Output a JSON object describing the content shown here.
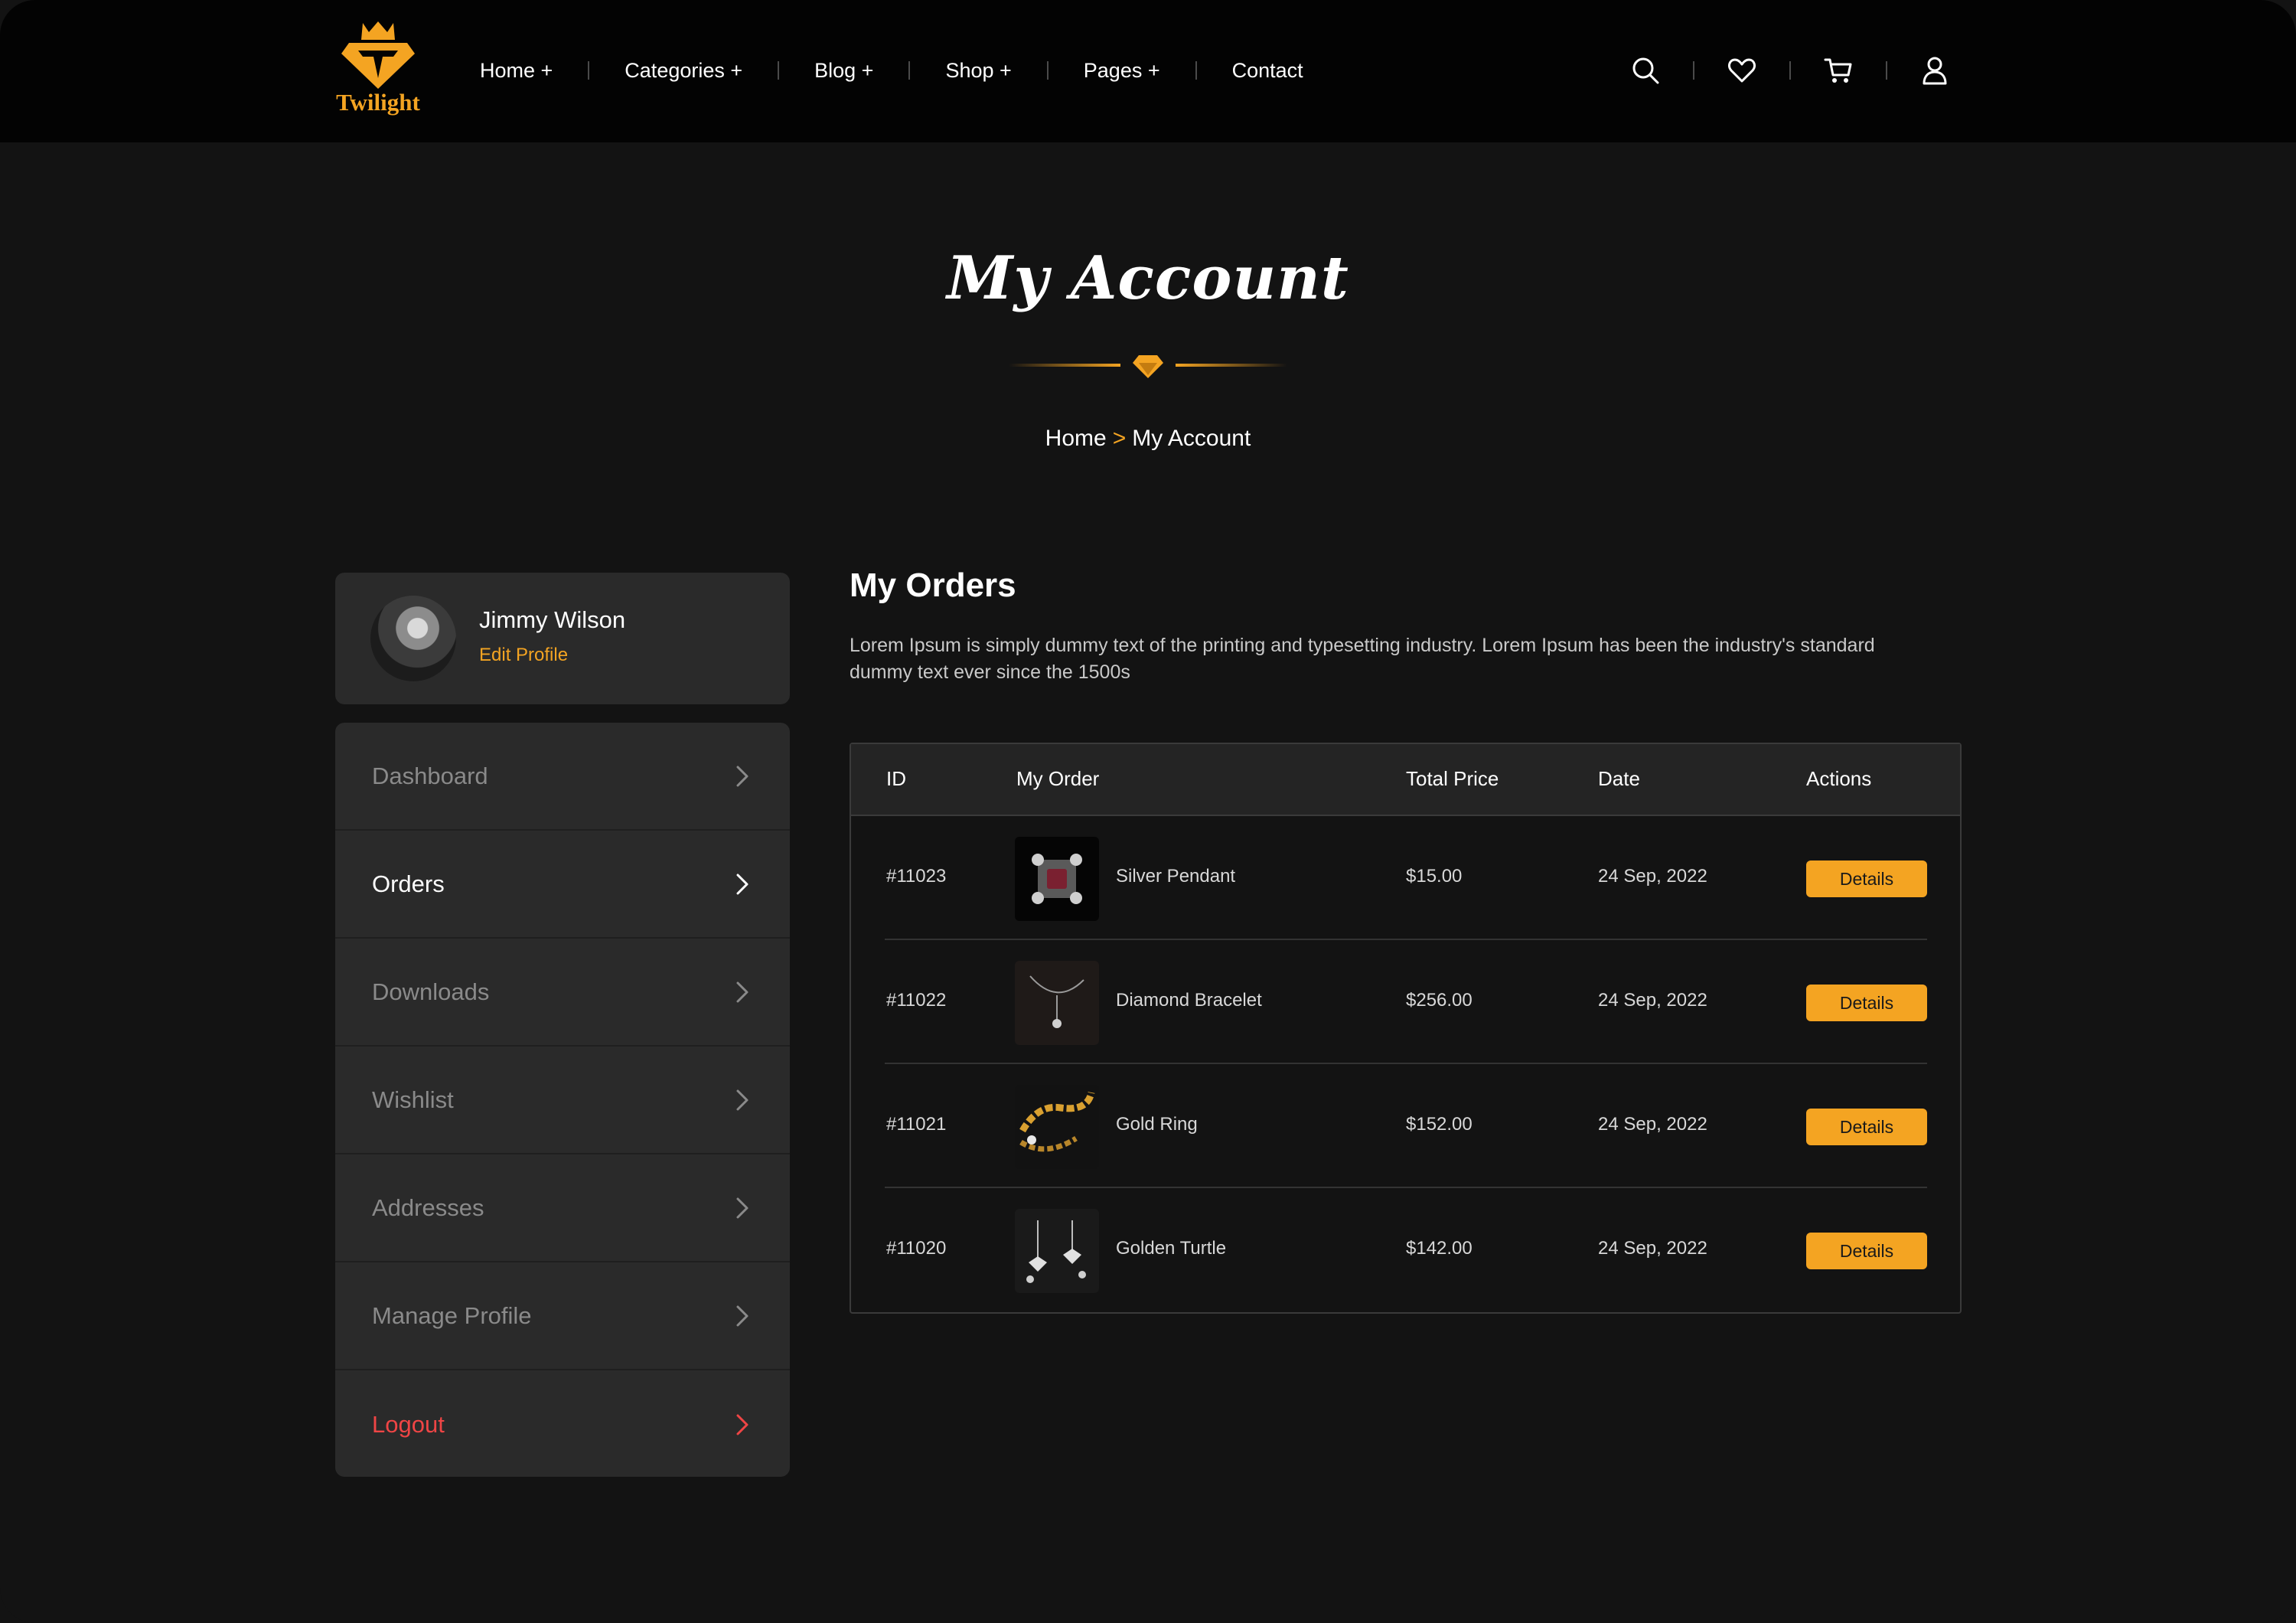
{
  "brand": {
    "name": "Twilight",
    "accent": "#f4a422"
  },
  "nav": {
    "items": [
      "Home +",
      "Categories +",
      "Blog +",
      "Shop +",
      "Pages +",
      "Contact"
    ]
  },
  "tools": [
    "search-icon",
    "heart-icon",
    "cart-icon",
    "user-icon"
  ],
  "hero": {
    "title": "My Account",
    "breadcrumb": {
      "home": "Home",
      "separator": ">",
      "current": "My Account"
    }
  },
  "profile": {
    "name": "Jimmy Wilson",
    "edit_label": "Edit Profile"
  },
  "menu": {
    "items": [
      "Dashboard",
      "Orders",
      "Downloads",
      "Wishlist",
      "Addresses",
      "Manage Profile",
      "Logout"
    ],
    "active": "Orders"
  },
  "orders": {
    "title": "My Orders",
    "description": "Lorem Ipsum is simply dummy text of the printing and typesetting industry. Lorem Ipsum has been the industry's standard dummy text ever since the 1500s",
    "columns": [
      "ID",
      "My Order",
      "Total Price",
      "Date",
      "Actions"
    ],
    "rows": [
      {
        "id": "#11023",
        "name": "Silver Pendant",
        "price": "$15.00",
        "date": "24 Sep, 2022",
        "action": "Details"
      },
      {
        "id": "#11022",
        "name": "Diamond Bracelet",
        "price": "$256.00",
        "date": "24 Sep, 2022",
        "action": "Details"
      },
      {
        "id": "#11021",
        "name": "Gold Ring",
        "price": "$152.00",
        "date": "24 Sep, 2022",
        "action": "Details"
      },
      {
        "id": "#11020",
        "name": "Golden Turtle",
        "price": "$142.00",
        "date": "24 Sep, 2022",
        "action": "Details"
      }
    ]
  }
}
